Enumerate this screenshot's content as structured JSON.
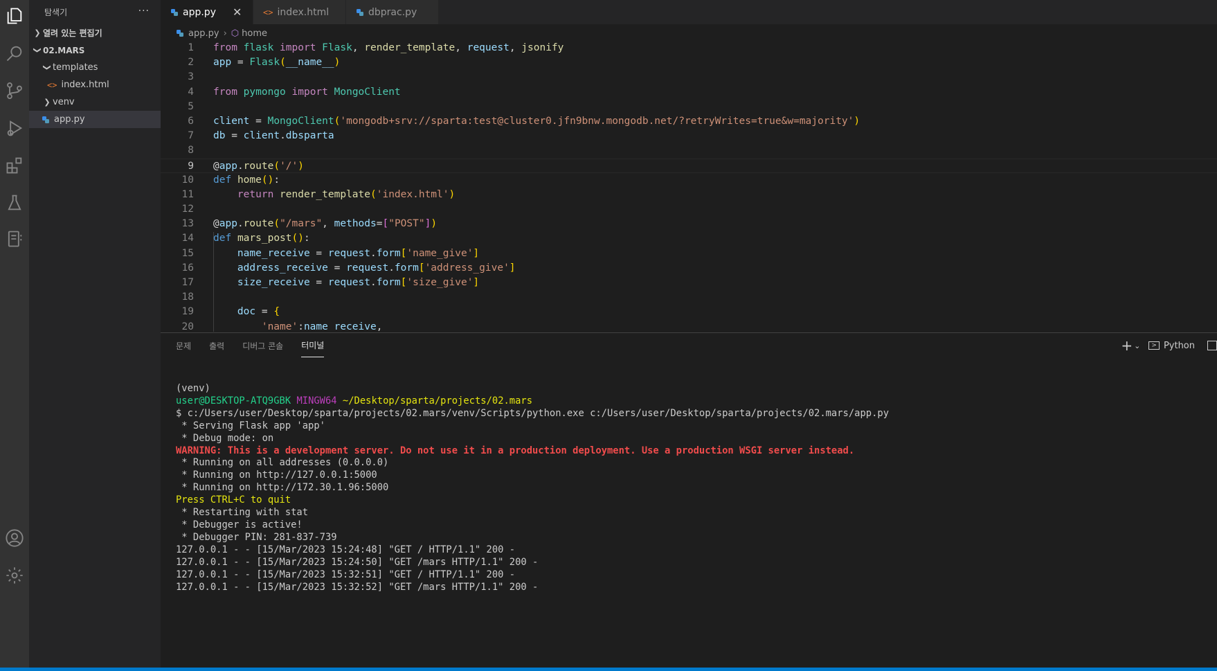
{
  "sidebar": {
    "title": "탐색기",
    "more": "···",
    "open_editors": "열려 있는 편집기",
    "folder": "02.MARS",
    "items": [
      {
        "label": "templates"
      },
      {
        "label": "index.html"
      },
      {
        "label": "venv"
      },
      {
        "label": "app.py"
      }
    ]
  },
  "tabs": [
    {
      "label": "app.py",
      "close": "✕"
    },
    {
      "label": "index.html"
    },
    {
      "label": "dbprac.py"
    }
  ],
  "breadcrumb": {
    "file": "app.py",
    "symbol": "home"
  },
  "code": {
    "line_numbers": [
      "1",
      "2",
      "3",
      "4",
      "5",
      "6",
      "7",
      "8",
      "9",
      "10",
      "11",
      "12",
      "13",
      "14",
      "15",
      "16",
      "17",
      "18",
      "19",
      "20"
    ]
  },
  "panel": {
    "tabs": [
      "문제",
      "출력",
      "디버그 콘솔",
      "터미널"
    ],
    "python_label": "Python",
    "add": "+"
  },
  "terminal": {
    "venv": "(venv)",
    "user_host": "user@DESKTOP-ATQ9GBK",
    "shell": "MINGW64",
    "path": "~/Desktop/sparta/projects/02.mars",
    "command": "$ c:/Users/user/Desktop/sparta/projects/02.mars/venv/Scripts/python.exe c:/Users/user/Desktop/sparta/projects/02.mars/app.py",
    "l1": " * Serving Flask app 'app'",
    "l2": " * Debug mode: on",
    "warning": "WARNING: This is a development server. Do not use it in a production deployment. Use a production WSGI server instead.",
    "l3": " * Running on all addresses (0.0.0.0)",
    "l4": " * Running on http://127.0.0.1:5000",
    "l5": " * Running on http://172.30.1.96:5000",
    "quit": "Press CTRL+C to quit",
    "l6": " * Restarting with stat",
    "l7": " * Debugger is active!",
    "l8": " * Debugger PIN: 281-837-739",
    "r1": "127.0.0.1 - - [15/Mar/2023 15:24:48] \"GET / HTTP/1.1\" 200 -",
    "r2": "127.0.0.1 - - [15/Mar/2023 15:24:50] \"GET /mars HTTP/1.1\" 200 -",
    "r3": "127.0.0.1 - - [15/Mar/2023 15:32:51] \"GET / HTTP/1.1\" 200 -",
    "r4": "127.0.0.1 - - [15/Mar/2023 15:32:52] \"GET /mars HTTP/1.1\" 200 -"
  },
  "colors": {
    "accent": "#007acc",
    "background": "#1e1e1e",
    "sidebar": "#252526",
    "activity_bar": "#333333"
  }
}
